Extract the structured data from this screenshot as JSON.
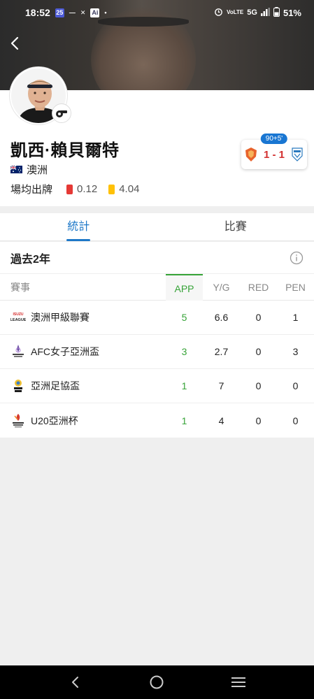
{
  "status_bar": {
    "time": "18:52",
    "battery": "51%",
    "network": "5G",
    "volte": "VoLTE"
  },
  "player": {
    "name": "凱西·賴貝爾特",
    "country": "澳洲",
    "cards_label": "場均出牌",
    "red_cards_avg": "0.12",
    "yellow_cards_avg": "4.04"
  },
  "match": {
    "time": "90+5'",
    "score": "1 - 1"
  },
  "tabs": [
    {
      "label": "統計",
      "active": true
    },
    {
      "label": "比賽",
      "active": false
    }
  ],
  "stats": {
    "period_title": "過去2年",
    "columns": [
      "賽事",
      "APP",
      "Y/G",
      "RED",
      "PEN"
    ],
    "rows": [
      {
        "competition": "澳洲甲級聯賽",
        "logo": "a-league-logo",
        "app": "5",
        "yg": "6.6",
        "red": "0",
        "pen": "1"
      },
      {
        "competition": "AFC女子亞洲盃",
        "logo": "afc-womens-asian-cup-logo",
        "app": "3",
        "yg": "2.7",
        "red": "0",
        "pen": "3"
      },
      {
        "competition": "亞洲足協盃",
        "logo": "afc-cup-logo",
        "app": "1",
        "yg": "7",
        "red": "0",
        "pen": "0"
      },
      {
        "competition": "U20亞洲杯",
        "logo": "afc-u20-asian-cup-logo",
        "app": "1",
        "yg": "4",
        "red": "0",
        "pen": "0"
      }
    ]
  },
  "colors": {
    "accent_blue": "#1e78c8",
    "app_green": "#37a338",
    "red_card": "#e53935",
    "yellow_card": "#ffc107",
    "score_red": "#d32f2f"
  }
}
